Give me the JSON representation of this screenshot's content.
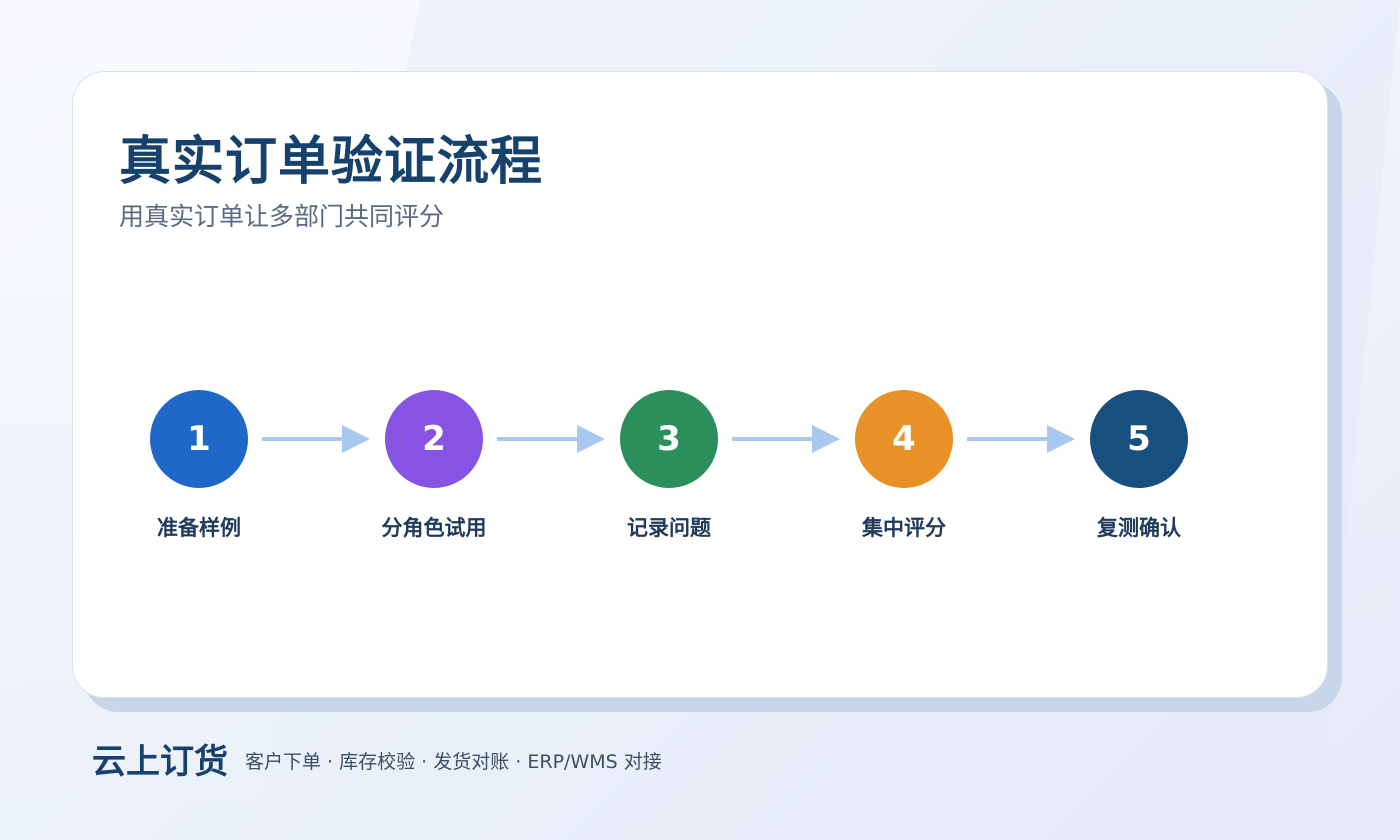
{
  "page": {
    "title": "真实订单验证流程",
    "subtitle": "用真实订单让多部门共同评分"
  },
  "steps": [
    {
      "number": "1",
      "label": "准备样例",
      "color": "#1f68c9"
    },
    {
      "number": "2",
      "label": "分角色试用",
      "color": "#8653e3"
    },
    {
      "number": "3",
      "label": "记录问题",
      "color": "#2a8f5b"
    },
    {
      "number": "4",
      "label": "集中评分",
      "color": "#e79126"
    },
    {
      "number": "5",
      "label": "复测确认",
      "color": "#17507f"
    }
  ],
  "arrow_color": "#a9c8ef",
  "footer": {
    "brand": "云上订货",
    "tagline": "客户下单 · 库存校验 · 发货对账 · ERP/WMS 对接"
  }
}
